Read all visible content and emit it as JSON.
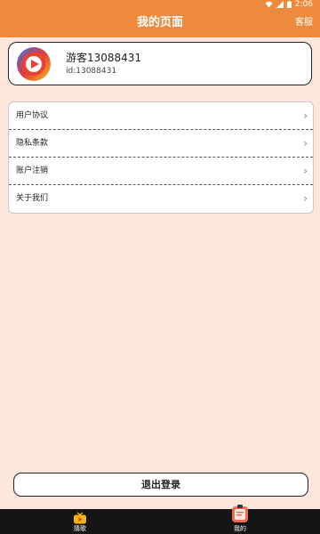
{
  "status_bar": {
    "time": "2:06"
  },
  "header": {
    "title": "我的页面",
    "action": "客服"
  },
  "profile": {
    "name": "游客13088431",
    "id_text": "id:13088431"
  },
  "menu": {
    "items": [
      {
        "label": "用户协议"
      },
      {
        "label": "隐私条款"
      },
      {
        "label": "账户注销"
      },
      {
        "label": "关于我们"
      }
    ]
  },
  "logout": {
    "label": "退出登录"
  },
  "bottom_nav": {
    "items": [
      {
        "label": "猜歌",
        "icon": "tv-play-icon"
      },
      {
        "label": "我的",
        "icon": "notes-icon"
      }
    ]
  },
  "colors": {
    "accent": "#ee8a3e",
    "page_bg": "#fde7dc",
    "nav_bg": "#151515"
  }
}
